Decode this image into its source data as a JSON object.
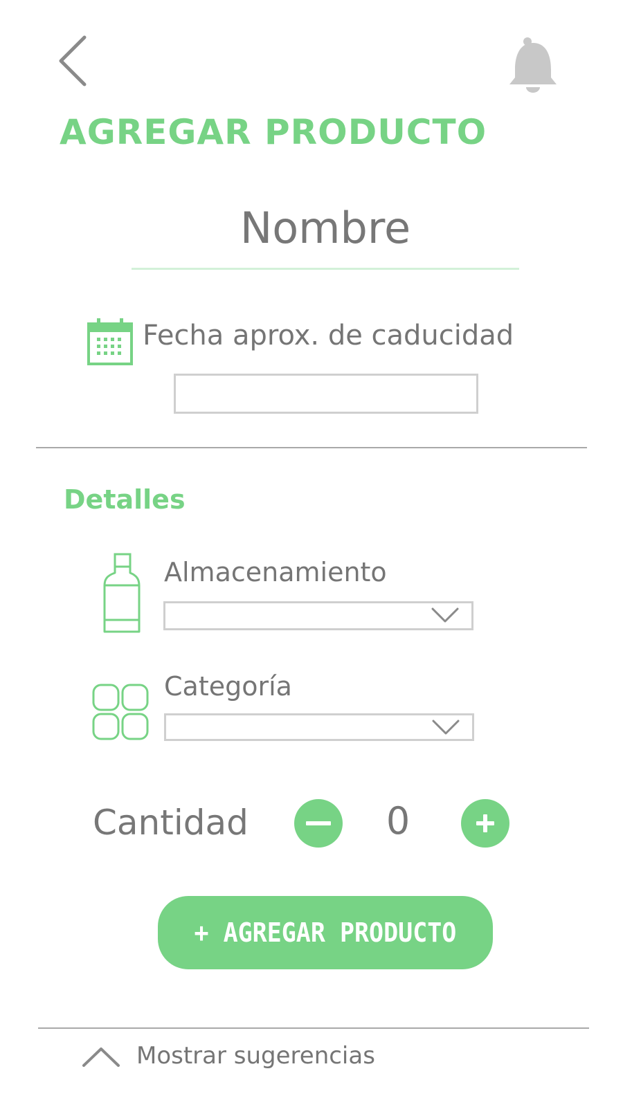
{
  "header": {
    "back_icon": "chevron-left-icon",
    "notification_icon": "bell-icon",
    "title": "AGREGAR PRODUCTO"
  },
  "name_field": {
    "placeholder": "Nombre",
    "value": ""
  },
  "expiry": {
    "icon": "calendar-icon",
    "label": "Fecha aprox. de caducidad",
    "value": ""
  },
  "details": {
    "heading": "Detalles",
    "storage": {
      "icon": "bottle-icon",
      "label": "Almacenamiento",
      "selected": ""
    },
    "category": {
      "icon": "grid-icon",
      "label": "Categoría",
      "selected": ""
    }
  },
  "quantity": {
    "label": "Cantidad",
    "value": "0"
  },
  "add_button": {
    "label": "+ AGREGAR PRODUCTO"
  },
  "suggestions": {
    "label": "Mostrar sugerencias",
    "icon": "chevron-up-icon"
  },
  "colors": {
    "accent": "#77d385",
    "text": "#777777",
    "border": "#cfcfcf",
    "icon_gray": "#c8c8c8"
  }
}
